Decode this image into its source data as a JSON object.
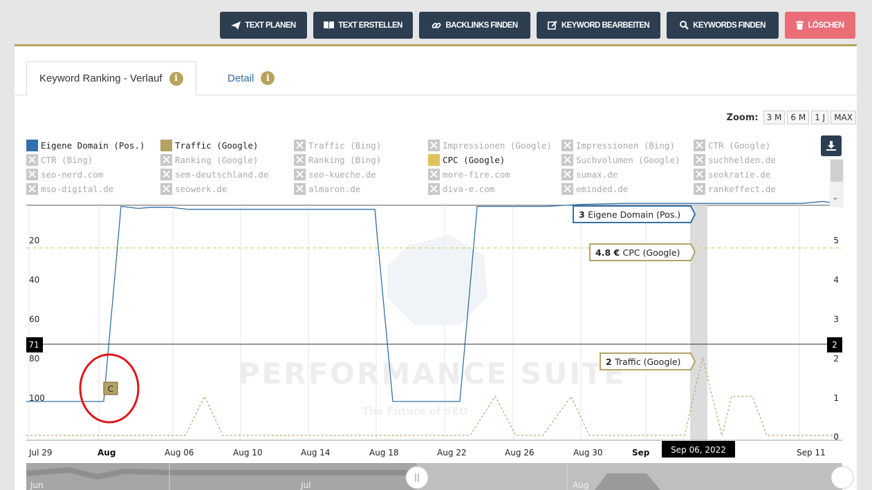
{
  "toolbar": {
    "buttons": [
      {
        "label": "TEXT PLANEN",
        "icon": "paper-plane-icon"
      },
      {
        "label": "TEXT ERSTELLEN",
        "icon": "book-open-icon"
      },
      {
        "label": "BACKLINKS FINDEN",
        "icon": "link-icon"
      },
      {
        "label": "KEYWORD BEARBEITEN",
        "icon": "edit-icon"
      },
      {
        "label": "KEYWORDS FINDEN",
        "icon": "search-icon"
      },
      {
        "label": "LÖSCHEN",
        "icon": "trash-icon"
      }
    ],
    "colors": {
      "dark": "#2c3e50",
      "danger": "#ea6d78"
    }
  },
  "tabs": [
    {
      "label": "Keyword Ranking - Verlauf",
      "active": true
    },
    {
      "label": "Detail",
      "active": false
    }
  ],
  "zoom": {
    "label": "Zoom:",
    "options": [
      "3 M",
      "6 M",
      "1 J",
      "MAX"
    ]
  },
  "legend": [
    {
      "label": "Eigene Domain (Pos.)",
      "enabled": true,
      "color": "#336fa8"
    },
    {
      "label": "Traffic (Google)",
      "enabled": true,
      "color": "#b5a265"
    },
    {
      "label": "Traffic (Bing)",
      "enabled": false
    },
    {
      "label": "Impressionen (Google)",
      "enabled": false
    },
    {
      "label": "Impressionen (Bing)",
      "enabled": false
    },
    {
      "label": "CTR (Google)",
      "enabled": false
    },
    {
      "label": "CTR (Bing)",
      "enabled": false
    },
    {
      "label": "Ranking (Google)",
      "enabled": false
    },
    {
      "label": "Ranking (Bing)",
      "enabled": false
    },
    {
      "label": "CPC (Google)",
      "enabled": true,
      "color": "#e0c35a"
    },
    {
      "label": "Suchvolumen (Google)",
      "enabled": false
    },
    {
      "label": "suchhelden.de",
      "enabled": false
    },
    {
      "label": "seo-nerd.com",
      "enabled": false
    },
    {
      "label": "sem-deutschland.de",
      "enabled": false
    },
    {
      "label": "seo-kueche.de",
      "enabled": false
    },
    {
      "label": "more-fire.com",
      "enabled": false
    },
    {
      "label": "sumax.de",
      "enabled": false
    },
    {
      "label": "seokratie.de",
      "enabled": false
    },
    {
      "label": "mso-digital.de",
      "enabled": false
    },
    {
      "label": "seowerk.de",
      "enabled": false
    },
    {
      "label": "almaron.de",
      "enabled": false
    },
    {
      "label": "diva-e.com",
      "enabled": false
    },
    {
      "label": "eminded.de",
      "enabled": false
    },
    {
      "label": "rankeffect.de",
      "enabled": false
    }
  ],
  "chart_data": {
    "type": "line",
    "x_ticks": [
      {
        "label": "Jul 29",
        "bold": false
      },
      {
        "label": "Aug",
        "bold": true
      },
      {
        "label": "Aug 06",
        "bold": false
      },
      {
        "label": "Aug 10",
        "bold": false
      },
      {
        "label": "Aug 14",
        "bold": false
      },
      {
        "label": "Aug 18",
        "bold": false
      },
      {
        "label": "Aug 22",
        "bold": false
      },
      {
        "label": "Aug 26",
        "bold": false
      },
      {
        "label": "Aug 30",
        "bold": false
      },
      {
        "label": "Sep",
        "bold": true
      },
      {
        "label": "Sep 11",
        "bold": false
      }
    ],
    "y_left": {
      "ticks": [
        "20",
        "40",
        "60",
        "80",
        "100"
      ],
      "reversed": true,
      "range": [
        0,
        110
      ]
    },
    "y_right": {
      "ticks": [
        "5",
        "4",
        "3",
        "2",
        "1",
        "0"
      ],
      "range": [
        0,
        5.6
      ]
    },
    "series": [
      {
        "name": "Eigene Domain (Pos.)",
        "color": "#336fa8",
        "points": [
          [
            -7,
            101
          ],
          [
            -2.5,
            101
          ],
          [
            -2,
            22
          ],
          [
            -1.5,
            3
          ],
          [
            -0.8,
            4
          ],
          [
            0,
            3.5
          ],
          [
            1.3,
            3.5
          ],
          [
            2,
            4.5
          ],
          [
            5,
            4.5
          ],
          [
            7,
            4.5
          ],
          [
            10.3,
            4.5
          ],
          [
            10.5,
            4.5
          ],
          [
            11.3,
            101
          ],
          [
            13.3,
            101
          ],
          [
            14.3,
            3
          ],
          [
            17.3,
            3
          ],
          [
            20,
            3
          ],
          [
            25,
            3
          ],
          [
            28.3,
            3
          ],
          [
            30,
            3
          ],
          [
            34,
            3
          ],
          [
            35,
            2.5
          ],
          [
            37,
            3
          ]
        ]
      },
      {
        "name": "Traffic (Google)",
        "color": "#b5a265",
        "dashed": true,
        "points": [
          [
            -7,
            0
          ],
          [
            -0.2,
            0
          ],
          [
            1,
            0
          ],
          [
            1.5,
            1
          ],
          [
            2.8,
            0
          ],
          [
            15.5,
            0
          ],
          [
            16.3,
            1
          ],
          [
            17.3,
            0
          ],
          [
            19.3,
            0
          ],
          [
            20.1,
            1
          ],
          [
            21.7,
            0
          ],
          [
            25.3,
            0
          ],
          [
            26.5,
            2
          ],
          [
            27.5,
            0
          ],
          [
            28.5,
            1
          ],
          [
            29,
            1
          ],
          [
            30.2,
            0
          ],
          [
            37,
            0
          ]
        ]
      },
      {
        "name": "CPC (Google)",
        "color": "#e0c35a",
        "dashed": true,
        "points": [
          [
            -7,
            4.8
          ],
          [
            37,
            4.8
          ]
        ]
      }
    ],
    "crosshair": {
      "left_value": "71",
      "right_value": "2",
      "date": "Sep 06, 2022"
    },
    "tooltips": [
      {
        "value": "3",
        "series": "Eigene Domain (Pos.)"
      },
      {
        "value": "4.8 €",
        "series": "CPC (Google)"
      },
      {
        "value": "2",
        "series": "Traffic (Google)"
      }
    ],
    "annotation_flag": "C",
    "navigator_labels": [
      "Jun",
      "Jul",
      "Aug"
    ],
    "watermark": {
      "title": "PERFORMANCE SUITE",
      "subtitle": "The Future of SEO"
    }
  }
}
